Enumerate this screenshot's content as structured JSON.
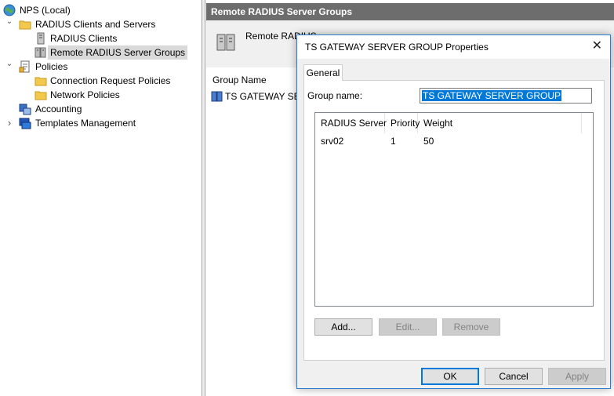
{
  "tree": {
    "items": [
      {
        "label": "NPS (Local)",
        "icon": "globe-icon",
        "expander": ""
      },
      {
        "label": "RADIUS Clients and Servers",
        "icon": "folder-icon",
        "expander": "⌄"
      },
      {
        "label": "RADIUS Clients",
        "icon": "server-icon",
        "expander": ""
      },
      {
        "label": "Remote RADIUS Server Groups",
        "icon": "server-group-icon",
        "expander": ""
      },
      {
        "label": "Policies",
        "icon": "policy-doc-icon",
        "expander": "⌄"
      },
      {
        "label": "Connection Request Policies",
        "icon": "folder-icon",
        "expander": ""
      },
      {
        "label": "Network Policies",
        "icon": "folder-icon",
        "expander": ""
      },
      {
        "label": "Accounting",
        "icon": "accounting-icon",
        "expander": ""
      },
      {
        "label": "Templates Management",
        "icon": "templates-icon",
        "expander": "›"
      }
    ]
  },
  "right": {
    "header": "Remote RADIUS Server Groups",
    "info_text": "Remote RADIUS",
    "info_icon": "server-group-icon",
    "column_header": "Group Name",
    "row_label": "TS GATEWAY SER"
  },
  "dialog": {
    "title": "TS GATEWAY SERVER GROUP Properties",
    "close_glyph": "✕",
    "tab_label": "General",
    "group_name_label": "Group name:",
    "group_name_value": "TS GATEWAY SERVER GROUP",
    "columns": [
      "RADIUS Server",
      "Priority",
      "Weight"
    ],
    "rows": [
      {
        "server": "srv02",
        "priority": "1",
        "weight": "50"
      }
    ],
    "add_label": "Add...",
    "edit_label": "Edit...",
    "remove_label": "Remove",
    "ok_label": "OK",
    "cancel_label": "Cancel",
    "apply_label": "Apply"
  },
  "colors": {
    "selection": "#0078d7",
    "header_bar": "#6d6d6d",
    "dialog_border": "#2b7bd0"
  }
}
